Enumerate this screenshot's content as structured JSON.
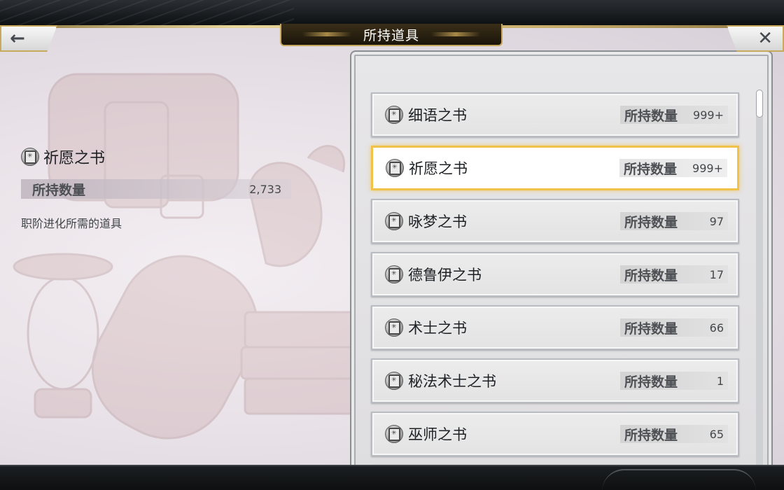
{
  "header": {
    "title": "所持道具",
    "back_icon": "←",
    "close_icon": "✕"
  },
  "detail": {
    "name": "祈愿之书",
    "qty_label": "所持数量",
    "qty_value": "2,733",
    "description": "职阶进化所需的道具"
  },
  "items": [
    {
      "name": "细语之书",
      "qty_label": "所持数量",
      "qty": "999+"
    },
    {
      "name": "祈愿之书",
      "qty_label": "所持数量",
      "qty": "999+"
    },
    {
      "name": "咏梦之书",
      "qty_label": "所持数量",
      "qty": "97"
    },
    {
      "name": "德鲁伊之书",
      "qty_label": "所持数量",
      "qty": "17"
    },
    {
      "name": "术士之书",
      "qty_label": "所持数量",
      "qty": "66"
    },
    {
      "name": "秘法术士之书",
      "qty_label": "所持数量",
      "qty": "1"
    },
    {
      "name": "巫师之书",
      "qty_label": "所持数量",
      "qty": "65"
    }
  ],
  "selected_index": 1,
  "colors": {
    "selected_border": "#f0c24a",
    "gold_trim": "#c7a85e"
  },
  "icons": {
    "item_icon": "book-icon"
  }
}
